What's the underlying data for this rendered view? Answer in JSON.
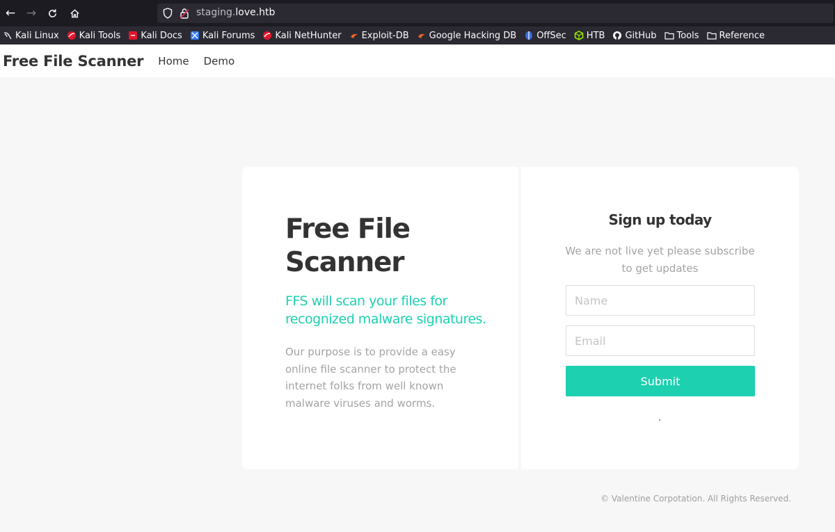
{
  "browser": {
    "url_prefix": "staging.",
    "url_host": "love.htb",
    "bookmarks": [
      {
        "label": "Kali Linux",
        "icon": "kali-dragon-icon"
      },
      {
        "label": "Kali Tools",
        "icon": "kali-tools-icon"
      },
      {
        "label": "Kali Docs",
        "icon": "kali-docs-icon"
      },
      {
        "label": "Kali Forums",
        "icon": "kali-forums-icon"
      },
      {
        "label": "Kali NetHunter",
        "icon": "kali-nethunter-icon"
      },
      {
        "label": "Exploit-DB",
        "icon": "exploit-db-icon"
      },
      {
        "label": "Google Hacking DB",
        "icon": "ghdb-icon"
      },
      {
        "label": "OffSec",
        "icon": "offsec-icon"
      },
      {
        "label": "HTB",
        "icon": "htb-icon"
      },
      {
        "label": "GitHub",
        "icon": "github-icon"
      },
      {
        "label": "Tools",
        "icon": "folder-icon"
      },
      {
        "label": "Reference",
        "icon": "folder-icon"
      }
    ]
  },
  "site": {
    "brand": "Free File Scanner",
    "nav": [
      {
        "label": "Home"
      },
      {
        "label": "Demo"
      }
    ]
  },
  "hero": {
    "title": "Free File Scanner",
    "tagline": "FFS will scan your files for recognized malware signatures.",
    "body": "Our purpose is to provide a easy online file scanner to protect the internet folks from well known malware viruses and worms."
  },
  "signup": {
    "title": "Sign up today",
    "subtitle": "We are not live yet please subscribe to get updates",
    "name_placeholder": "Name",
    "email_placeholder": "Email",
    "submit_label": "Submit"
  },
  "footer": {
    "text": "© Valentine Corpotation. All Rights Reserved."
  },
  "colors": {
    "accent": "#1dd0b0",
    "chrome_dark": "#1c1b22",
    "page_bg": "#f7f7f7"
  }
}
